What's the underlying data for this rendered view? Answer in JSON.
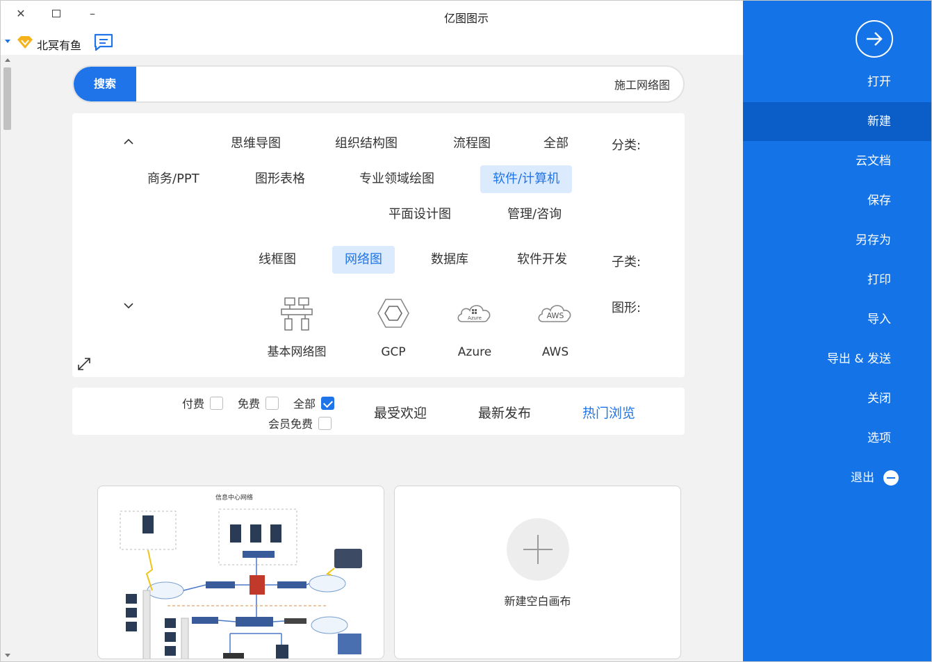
{
  "window": {
    "title": "亿图图示",
    "close_glyph": "✕",
    "max_glyph": "☐",
    "min_glyph": "–"
  },
  "user": {
    "name": "北冥有鱼"
  },
  "search": {
    "button_label": "搜索",
    "value": "施工网络图"
  },
  "filters": {
    "category_label": "分类:",
    "categories_row1": [
      "全部",
      "流程图",
      "组织结构图",
      "思维导图"
    ],
    "categories_row2": [
      "软件/计算机",
      "专业领域绘图",
      "图形表格",
      "商务/PPT"
    ],
    "categories_row3": [
      "管理/咨询",
      "平面设计图"
    ],
    "subcategory_label": "子类:",
    "subcategories": [
      "软件开发",
      "数据库",
      "网络图",
      "线框图"
    ],
    "shapes_label": "图形:",
    "shapes": [
      "AWS",
      "Azure",
      "GCP",
      "基本网络图"
    ],
    "aws_icon_text": "AWS",
    "azure_icon_text": "Azure",
    "active_category": "软件/计算机",
    "active_subcategory": "网络图"
  },
  "sortbar": {
    "tabs": [
      "热门浏览",
      "最新发布",
      "最受欢迎"
    ],
    "active_tab": "热门浏览",
    "checkboxes": [
      {
        "label": "全部",
        "checked": true
      },
      {
        "label": "免费",
        "checked": false
      },
      {
        "label": "付费",
        "checked": false
      },
      {
        "label": "会员免费",
        "checked": false
      }
    ]
  },
  "templates": {
    "new_blank_label": "新建空白画布",
    "network_title": "信息中心网络"
  },
  "sidebar": {
    "items": [
      "打开",
      "新建",
      "云文档",
      "保存",
      "另存为",
      "打印",
      "导入",
      "导出 & 发送",
      "关闭",
      "选项",
      "退出"
    ],
    "active": "新建"
  },
  "colors": {
    "accent": "#1e74e8",
    "sidebar_bg": "#1473e6",
    "sidebar_active": "#0b5ec7",
    "active_chip_bg": "#dceafd"
  }
}
